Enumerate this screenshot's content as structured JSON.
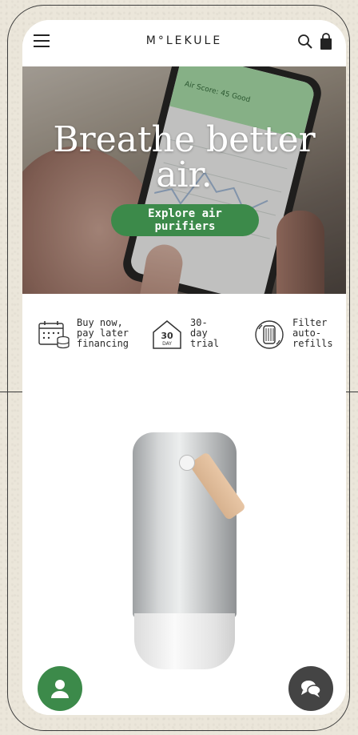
{
  "header": {
    "brand": "M°LEKULE",
    "icons": [
      "menu-icon",
      "search-icon",
      "shopping-bag-icon"
    ]
  },
  "hero": {
    "title": "Breathe better air.",
    "cta_label": "Explore air purifiers",
    "phone_screen_text": "Air Score: 45 Good"
  },
  "features": [
    {
      "icon": "calendar-coins-icon",
      "text": "Buy now,\npay later\nfinancing"
    },
    {
      "icon": "house-30-day-icon",
      "icon_text": "30\nDAY",
      "text": "30-\nday\ntrial"
    },
    {
      "icon": "filter-cylinder-icon",
      "text": "Filter\nauto-\nrefills"
    }
  ],
  "fabs": {
    "account": "user-icon",
    "chat": "chat-bubbles-icon"
  },
  "colors": {
    "accent_green": "#3c8a4a",
    "chat_button": "#444444"
  }
}
